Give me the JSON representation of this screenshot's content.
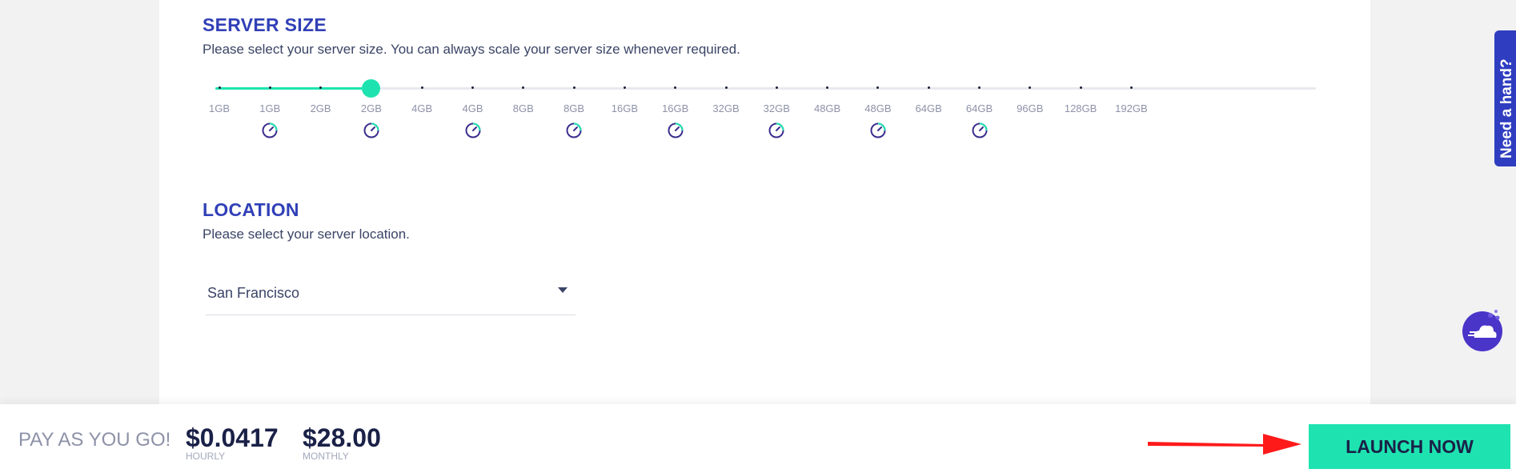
{
  "server_size": {
    "title": "SERVER SIZE",
    "description": "Please select your server size. You can always scale your server size whenever required.",
    "ticks": [
      "1GB",
      "1GB",
      "2GB",
      "2GB",
      "4GB",
      "4GB",
      "8GB",
      "8GB",
      "16GB",
      "16GB",
      "32GB",
      "32GB",
      "48GB",
      "48GB",
      "64GB",
      "64GB",
      "96GB",
      "128GB",
      "192GB"
    ],
    "ssd_marked_indices": [
      1,
      3,
      5,
      7,
      9,
      11,
      13,
      15
    ],
    "selected_index": 3
  },
  "location": {
    "title": "LOCATION",
    "description": "Please select your server location.",
    "selected": "San Francisco"
  },
  "help_tab": {
    "label": "Need a hand?"
  },
  "footer": {
    "payg_label": "PAY AS YOU GO!",
    "hourly_price": "$0.0417",
    "hourly_label": "HOURLY",
    "monthly_price": "$28.00",
    "monthly_label": "MONTHLY",
    "launch_label": "LAUNCH NOW"
  },
  "colors": {
    "accent": "#1ee3b0",
    "heading": "#3140b7",
    "help_tab": "#2f3ec0",
    "annotation_arrow": "#ff0000"
  },
  "icons": {
    "ssd": "speedometer-icon",
    "chat": "cloud-chat-icon",
    "dropdown": "caret-down-icon"
  }
}
